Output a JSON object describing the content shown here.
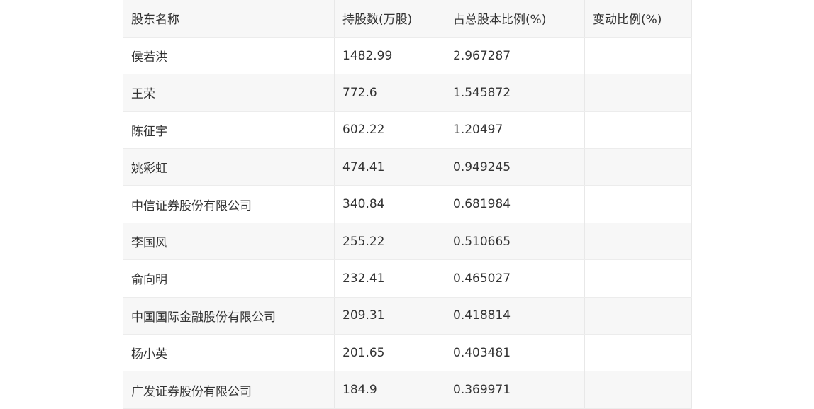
{
  "table": {
    "headers": [
      "股东名称",
      "持股数(万股)",
      "占总股本比例(%)",
      "变动比例(%)"
    ],
    "rows": [
      [
        "侯若洪",
        "1482.99",
        "2.967287",
        ""
      ],
      [
        "王荣",
        "772.6",
        "1.545872",
        ""
      ],
      [
        "陈征宇",
        "602.22",
        "1.20497",
        ""
      ],
      [
        "姚彩虹",
        "474.41",
        "0.949245",
        ""
      ],
      [
        "中信证券股份有限公司",
        "340.84",
        "0.681984",
        ""
      ],
      [
        "李国风",
        "255.22",
        "0.510665",
        ""
      ],
      [
        "俞向明",
        "232.41",
        "0.465027",
        ""
      ],
      [
        "中国国际金融股份有限公司",
        "209.31",
        "0.418814",
        ""
      ],
      [
        "杨小英",
        "201.65",
        "0.403481",
        ""
      ],
      [
        "广发证券股份有限公司",
        "184.9",
        "0.369971",
        ""
      ]
    ]
  }
}
